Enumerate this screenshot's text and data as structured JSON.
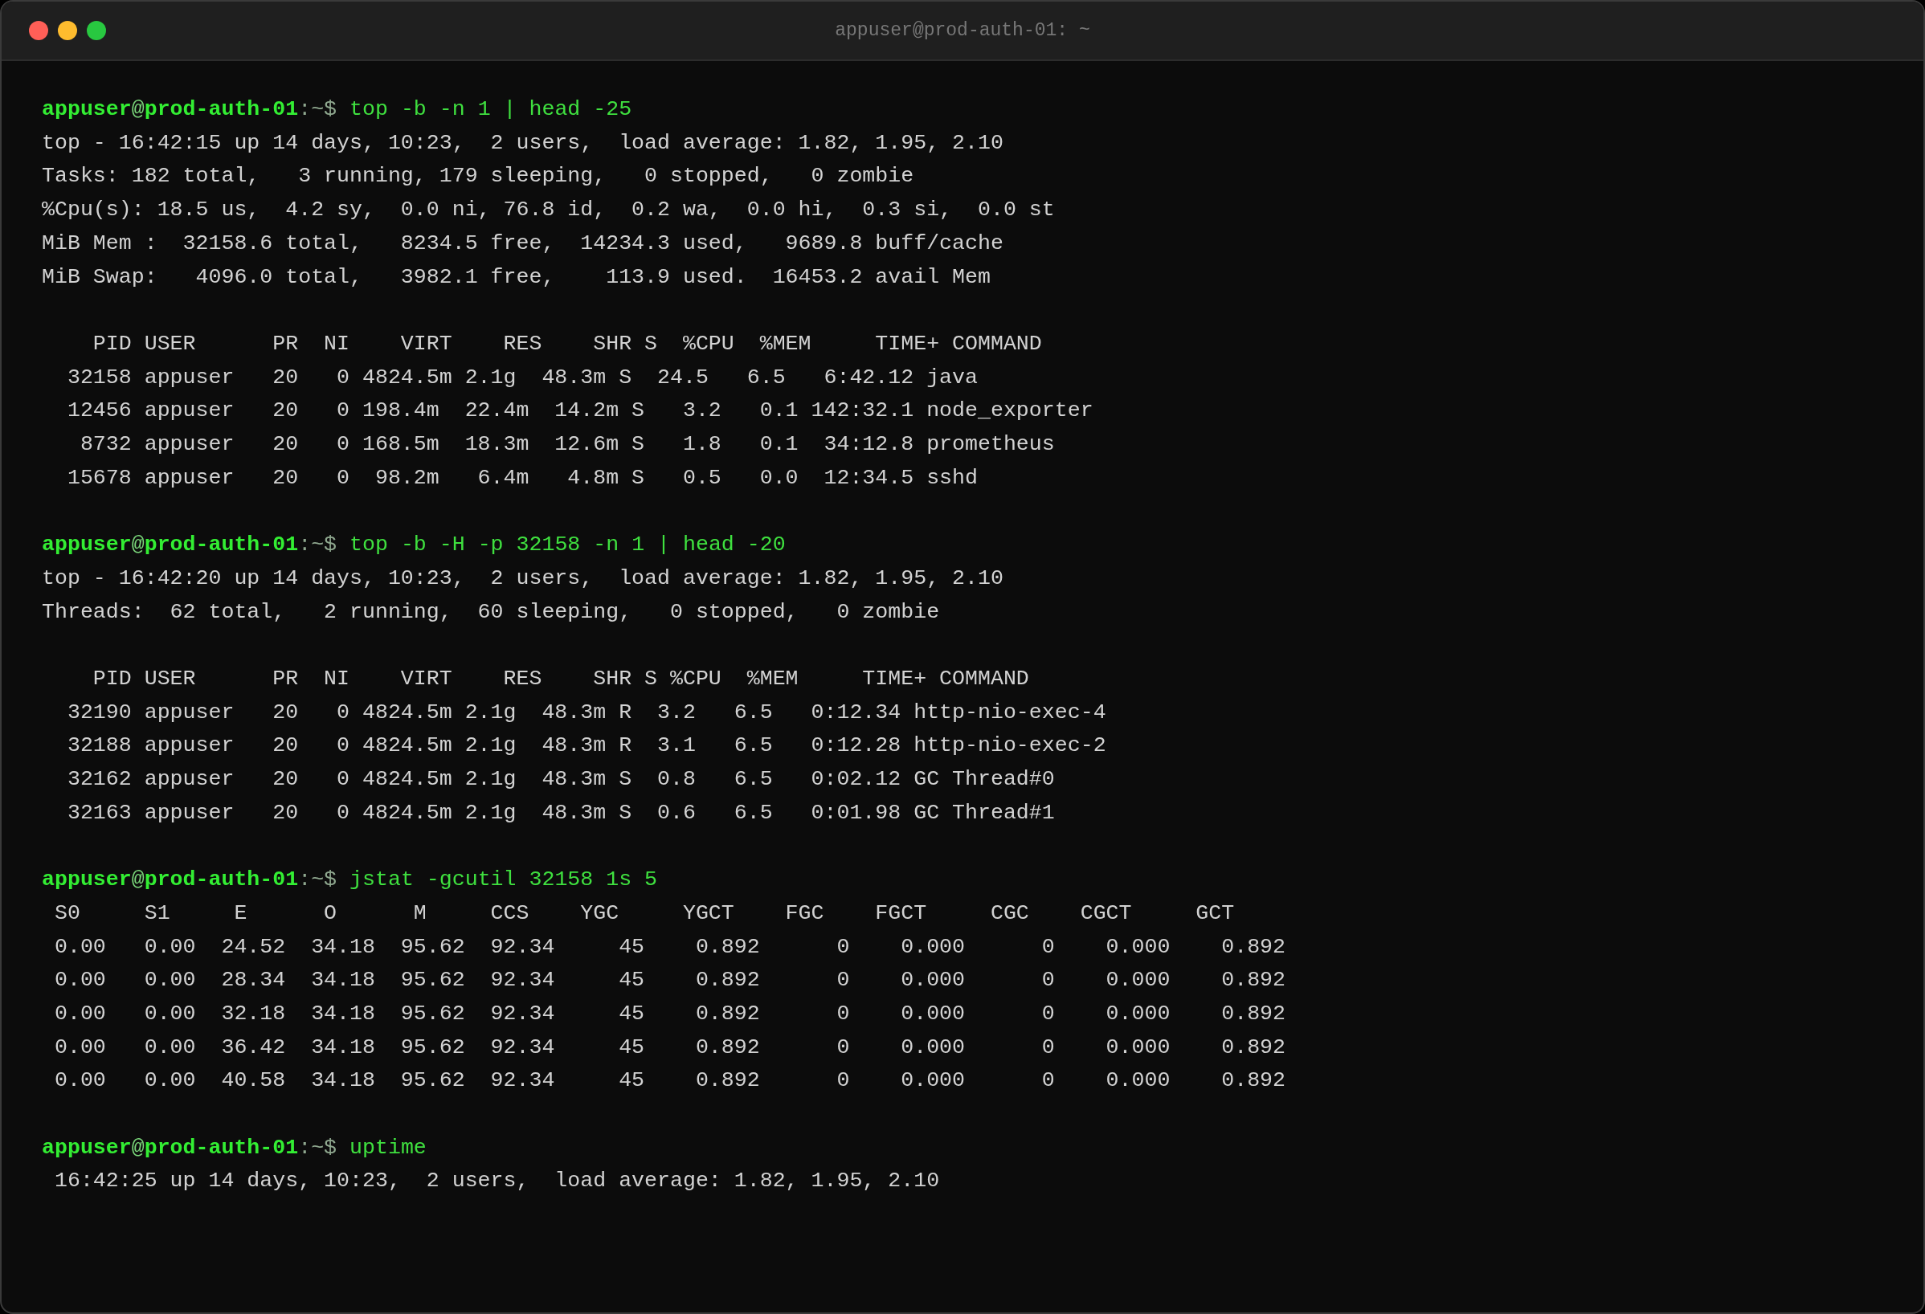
{
  "window": {
    "title": "appuser@prod-auth-01: ~"
  },
  "blocks": [
    {
      "prompt": {
        "user": "appuser",
        "at": "@",
        "host": "prod-auth-01",
        "suffix": ":~$"
      },
      "command": "top -b -n 1 | head -25",
      "groups": [
        [
          "top - 16:42:15 up 14 days, 10:23,  2 users,  load average: 1.82, 1.95, 2.10",
          "Tasks: 182 total,   3 running, 179 sleeping,   0 stopped,   0 zombie",
          "%Cpu(s): 18.5 us,  4.2 sy,  0.0 ni, 76.8 id,  0.2 wa,  0.0 hi,  0.3 si,  0.0 st",
          "MiB Mem :  32158.6 total,   8234.5 free,  14234.3 used,   9689.8 buff/cache",
          "MiB Swap:   4096.0 total,   3982.1 free,    113.9 used.  16453.2 avail Mem"
        ],
        [
          "    PID USER      PR  NI    VIRT    RES    SHR S  %CPU  %MEM     TIME+ COMMAND",
          "  32158 appuser   20   0 4824.5m 2.1g  48.3m S  24.5   6.5   6:42.12 java",
          "  12456 appuser   20   0 198.4m  22.4m  14.2m S   3.2   0.1 142:32.1 node_exporter",
          "   8732 appuser   20   0 168.5m  18.3m  12.6m S   1.8   0.1  34:12.8 prometheus",
          "  15678 appuser   20   0  98.2m   6.4m   4.8m S   0.5   0.0  12:34.5 sshd"
        ]
      ]
    },
    {
      "prompt": {
        "user": "appuser",
        "at": "@",
        "host": "prod-auth-01",
        "suffix": ":~$"
      },
      "command": "top -b -H -p 32158 -n 1 | head -20",
      "groups": [
        [
          "top - 16:42:20 up 14 days, 10:23,  2 users,  load average: 1.82, 1.95, 2.10",
          "Threads:  62 total,   2 running,  60 sleeping,   0 stopped,   0 zombie"
        ],
        [
          "    PID USER      PR  NI    VIRT    RES    SHR S %CPU  %MEM     TIME+ COMMAND",
          "  32190 appuser   20   0 4824.5m 2.1g  48.3m R  3.2   6.5   0:12.34 http-nio-exec-4",
          "  32188 appuser   20   0 4824.5m 2.1g  48.3m R  3.1   6.5   0:12.28 http-nio-exec-2",
          "  32162 appuser   20   0 4824.5m 2.1g  48.3m S  0.8   6.5   0:02.12 GC Thread#0",
          "  32163 appuser   20   0 4824.5m 2.1g  48.3m S  0.6   6.5   0:01.98 GC Thread#1"
        ]
      ]
    },
    {
      "prompt": {
        "user": "appuser",
        "at": "@",
        "host": "prod-auth-01",
        "suffix": ":~$"
      },
      "command": "jstat -gcutil 32158 1s 5",
      "groups": [
        [
          " S0     S1     E      O      M     CCS    YGC     YGCT    FGC    FGCT     CGC    CGCT     GCT",
          " 0.00   0.00  24.52  34.18  95.62  92.34     45    0.892      0    0.000      0    0.000    0.892",
          " 0.00   0.00  28.34  34.18  95.62  92.34     45    0.892      0    0.000      0    0.000    0.892",
          " 0.00   0.00  32.18  34.18  95.62  92.34     45    0.892      0    0.000      0    0.000    0.892",
          " 0.00   0.00  36.42  34.18  95.62  92.34     45    0.892      0    0.000      0    0.000    0.892",
          " 0.00   0.00  40.58  34.18  95.62  92.34     45    0.892      0    0.000      0    0.000    0.892"
        ]
      ]
    },
    {
      "prompt": {
        "user": "appuser",
        "at": "@",
        "host": "prod-auth-01",
        "suffix": ":~$"
      },
      "command": "uptime",
      "groups": [
        [
          " 16:42:25 up 14 days, 10:23,  2 users,  load average: 1.82, 1.95, 2.10"
        ]
      ]
    }
  ]
}
